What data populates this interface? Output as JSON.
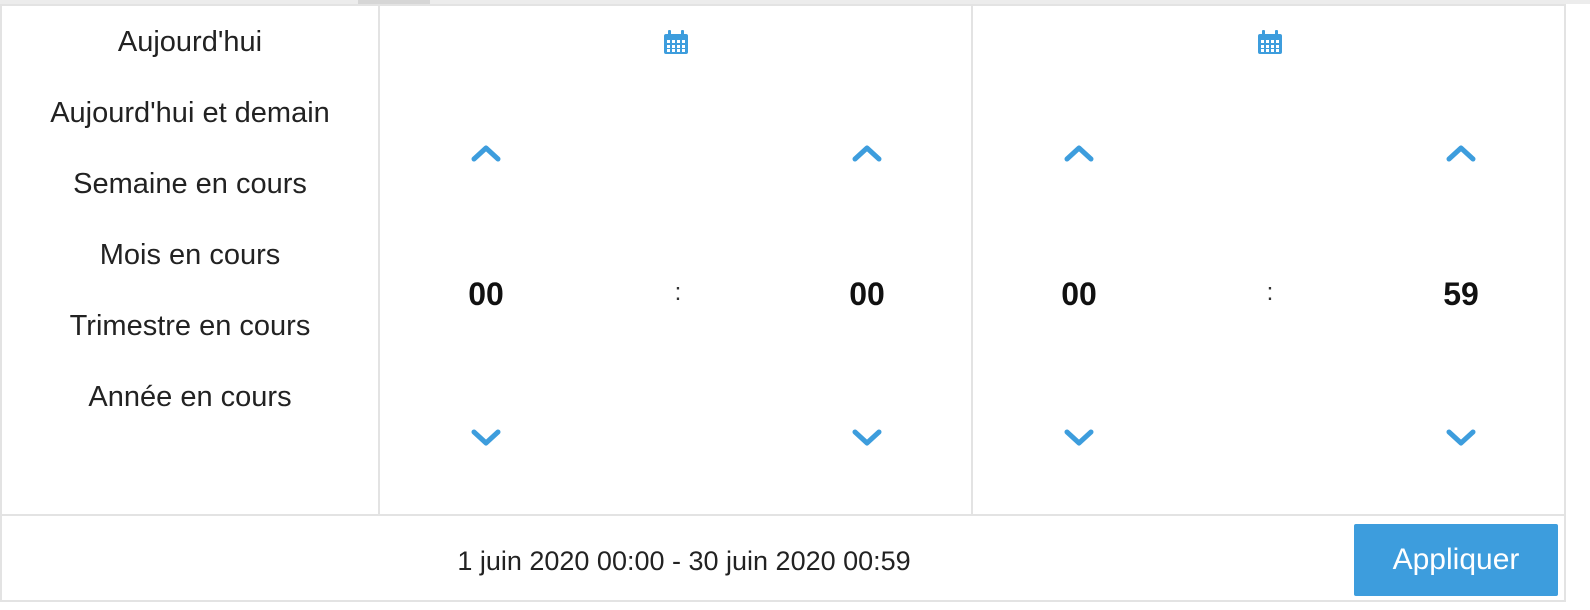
{
  "presets": [
    {
      "label": "Aujourd'hui"
    },
    {
      "label": "Aujourd'hui et demain"
    },
    {
      "label": "Semaine en cours"
    },
    {
      "label": "Mois en cours"
    },
    {
      "label": "Trimestre en cours"
    },
    {
      "label": "Année en cours"
    }
  ],
  "start_time": {
    "hours": "00",
    "separator": ":",
    "minutes": "00"
  },
  "end_time": {
    "hours": "00",
    "separator": ":",
    "minutes": "59"
  },
  "footer": {
    "range_text": "1 juin 2020 00:00 - 30 juin 2020 00:59",
    "apply_label": "Appliquer"
  },
  "colors": {
    "accent": "#3d9ddd",
    "border": "#e3e3e3"
  },
  "icons": {
    "calendar": "calendar-icon",
    "up": "chevron-up-icon",
    "down": "chevron-down-icon"
  }
}
